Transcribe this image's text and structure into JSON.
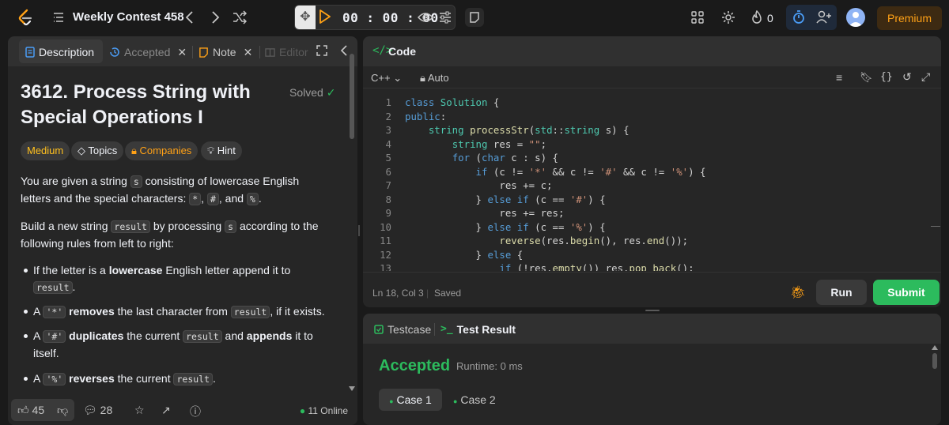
{
  "topbar": {
    "contest_title": "Weekly Contest 458",
    "timer": "00 : 00 : 00",
    "streak_count": "0",
    "premium_label": "Premium"
  },
  "left_panel": {
    "tabs": {
      "description": "Description",
      "accepted": "Accepted",
      "note": "Note",
      "editorial": "Editor"
    },
    "problem_title": "3612. Process String with Special Operations I",
    "solved_label": "Solved",
    "tags": {
      "difficulty": "Medium",
      "topics": "Topics",
      "companies": "Companies",
      "hint": "Hint"
    },
    "intro": {
      "p1_a": "You are given a string",
      "p1_code_s": "s",
      "p1_b": "consisting of lowercase English letters and the special characters:",
      "p1_star": "*",
      "p1_hash": "#",
      "p1_and": ", and",
      "p1_pct": "%",
      "p2_a": "Build a new string",
      "p2_code_result": "result",
      "p2_b": "by processing",
      "p2_code_s": "s",
      "p2_c": "according to the following rules from left to right:"
    },
    "rules": [
      {
        "a": "If the letter is a",
        "bold": "lowercase",
        "b": "English letter append it to",
        "code": "result",
        "c": "."
      },
      {
        "code": "'*'",
        "bold": "removes",
        "a": "the last character from",
        "code2": "result",
        "b": ", if it exists."
      },
      {
        "code": "'#'",
        "bold": "duplicates",
        "a": "the current",
        "code2": "result",
        "b": "and",
        "bold2": "appends",
        "c": "it to itself."
      },
      {
        "code": "'%'",
        "bold": "reverses",
        "a": "the current",
        "code2": "result",
        "b": "."
      }
    ],
    "bottom": {
      "likes": "45",
      "comments": "28",
      "online": "11 Online"
    }
  },
  "code_panel": {
    "title": "Code",
    "language": "C++",
    "mode": "Auto",
    "lines": [
      {
        "n": "1"
      },
      {
        "n": "2"
      },
      {
        "n": "3"
      },
      {
        "n": "4"
      },
      {
        "n": "5"
      },
      {
        "n": "6"
      },
      {
        "n": "7"
      },
      {
        "n": "8"
      },
      {
        "n": "9"
      },
      {
        "n": "10"
      },
      {
        "n": "11"
      },
      {
        "n": "12"
      },
      {
        "n": "13"
      }
    ],
    "status": "Ln 18, Col 3",
    "saved": "Saved",
    "run_label": "Run",
    "submit_label": "Submit"
  },
  "test_panel": {
    "testcase_tab": "Testcase",
    "result_tab": "Test Result",
    "verdict": "Accepted",
    "runtime": "Runtime: 0 ms",
    "cases": [
      "Case 1",
      "Case 2"
    ]
  },
  "colors": {
    "accent_orange": "#ffa116",
    "accepted_green": "#2cbb5d",
    "medium_yellow": "#ffc01e"
  }
}
